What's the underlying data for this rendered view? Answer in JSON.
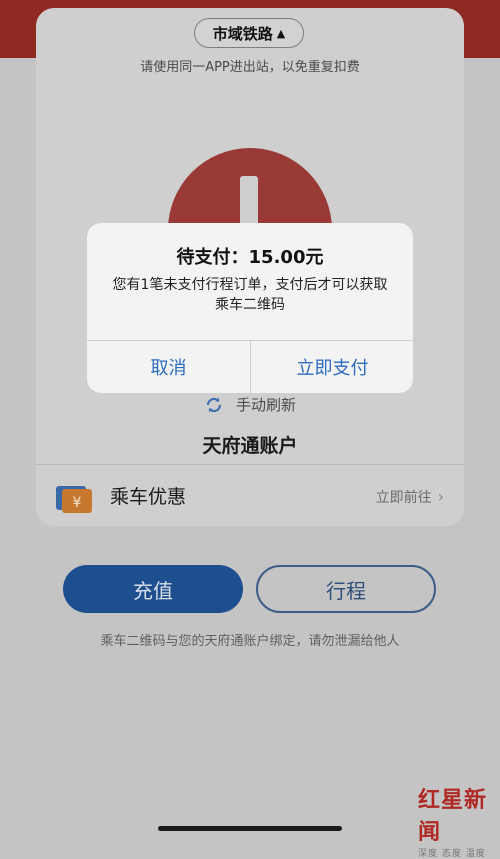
{
  "line_selector": {
    "label": "市域铁路",
    "arrow": "▲"
  },
  "hint_text": "请使用同一APP进出站，以免重复扣费",
  "refresh": {
    "label": "手动刷新",
    "icon": "refresh-icon"
  },
  "account": {
    "title": "天府通账户"
  },
  "benefit": {
    "icon": "ticket-icon",
    "label": "乘车优惠",
    "action": "立即前往",
    "chevron": "›"
  },
  "buttons": {
    "recharge": "充值",
    "trips": "行程"
  },
  "footer_note": "乘车二维码与您的天府通账户绑定，请勿泄漏给他人",
  "dialog": {
    "title": "待支付：15.00元",
    "message": "您有1笔未支付行程订单，支付后才可以获取乘车二维码",
    "cancel": "取消",
    "pay": "立即支付"
  },
  "watermark": {
    "logo": "红星新闻",
    "subtitle": "深度 态度 温度"
  },
  "colors": {
    "brand_red": "#8f2a22",
    "primary_blue": "#1d4f8f",
    "link_blue": "#2d6bbf",
    "alert_red": "#9a3a36"
  }
}
